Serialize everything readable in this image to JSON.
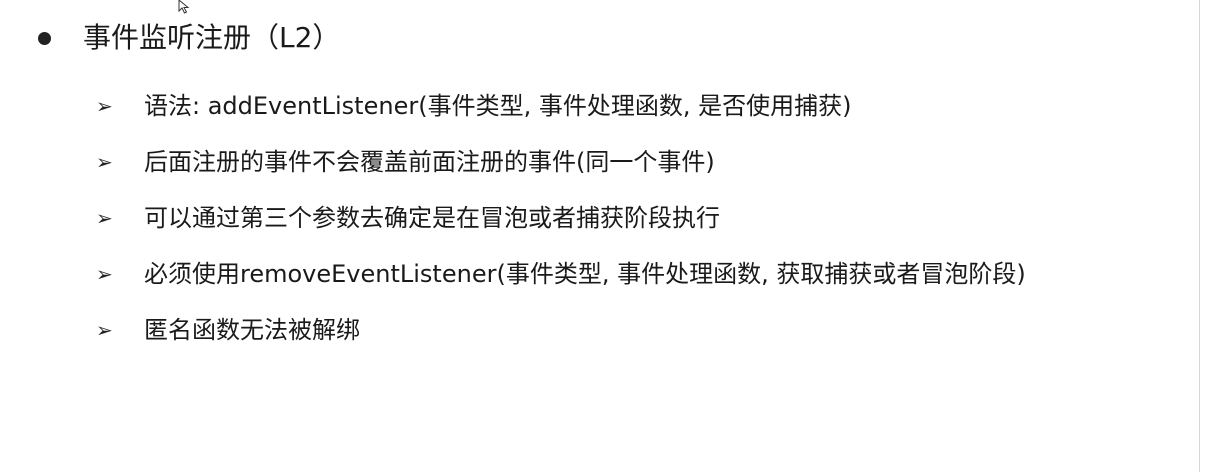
{
  "heading": {
    "text": "事件监听注册（L2）"
  },
  "points": [
    {
      "marker": "➢",
      "text": "语法: addEventListener(事件类型, 事件处理函数, 是否使用捕获)"
    },
    {
      "marker": "➢",
      "text": "后面注册的事件不会覆盖前面注册的事件(同一个事件)"
    },
    {
      "marker": "➢",
      "text": "可以通过第三个参数去确定是在冒泡或者捕获阶段执行"
    },
    {
      "marker": "➢",
      "text": "必须使用removeEventListener(事件类型, 事件处理函数, 获取捕获或者冒泡阶段)"
    },
    {
      "marker": "➢",
      "text": "匿名函数无法被解绑"
    }
  ],
  "icons": {
    "cursor": "mouse-pointer-icon",
    "bullet": "filled-circle-bullet-icon",
    "arrow": "arrow-bullet-icon"
  }
}
